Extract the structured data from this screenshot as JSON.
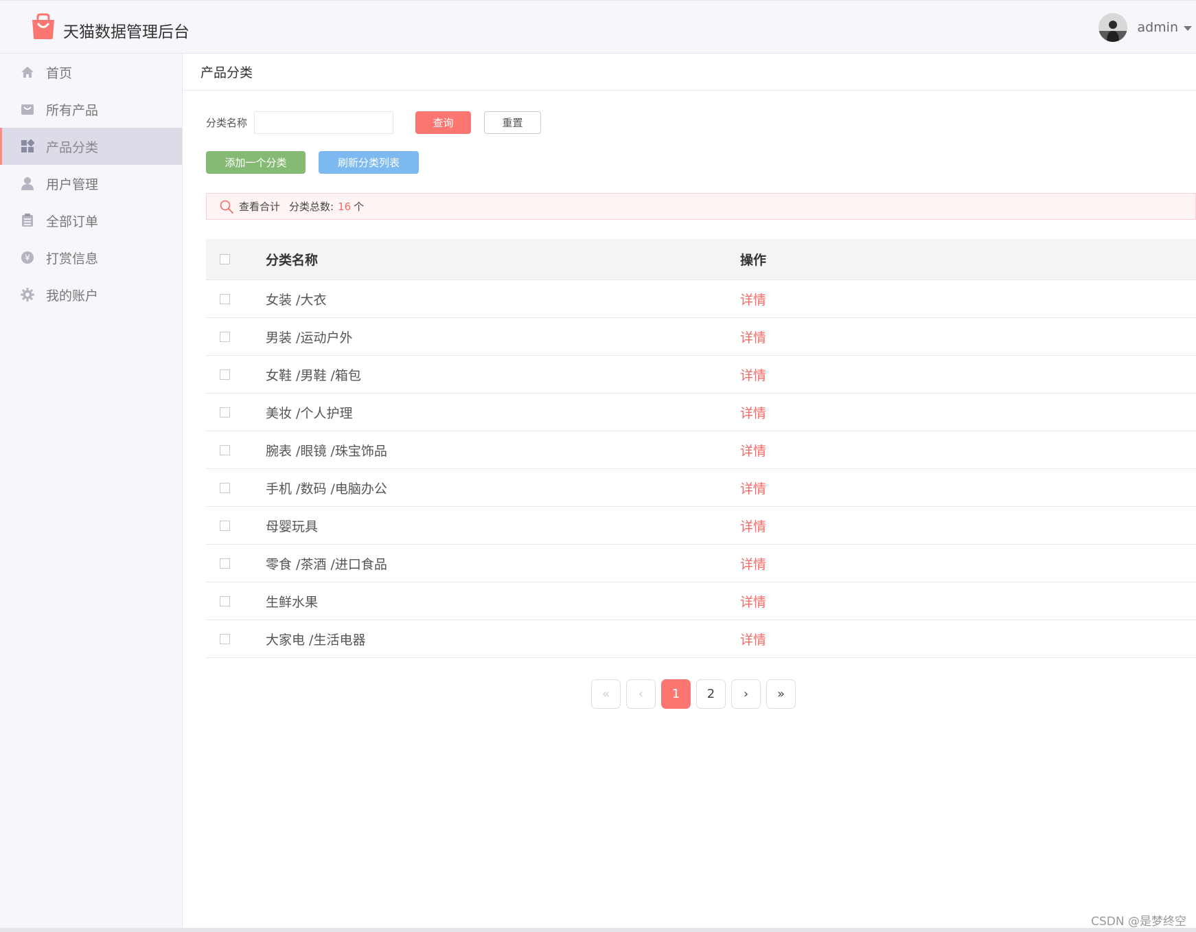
{
  "header": {
    "app_title": "天猫数据管理后台",
    "username": "admin"
  },
  "sidebar": {
    "items": [
      {
        "label": "首页",
        "icon": "home-icon",
        "active": false
      },
      {
        "label": "所有产品",
        "icon": "bag-icon",
        "active": false
      },
      {
        "label": "产品分类",
        "icon": "category-icon",
        "active": true
      },
      {
        "label": "用户管理",
        "icon": "user-icon",
        "active": false
      },
      {
        "label": "全部订单",
        "icon": "order-icon",
        "active": false
      },
      {
        "label": "打赏信息",
        "icon": "yen-icon",
        "active": false
      },
      {
        "label": "我的账户",
        "icon": "gear-icon",
        "active": false
      }
    ]
  },
  "breadcrumb": "产品分类",
  "search": {
    "label": "分类名称",
    "value": "",
    "placeholder": "",
    "query_label": "查询",
    "reset_label": "重置"
  },
  "actions": {
    "add_label": "添加一个分类",
    "refresh_label": "刷新分类列表"
  },
  "summary": {
    "label": "查看合计",
    "total_label": "分类总数:",
    "count": "16",
    "unit": "个"
  },
  "table": {
    "headers": {
      "name": "分类名称",
      "op": "操作"
    },
    "rows": [
      {
        "name": "女装 /大衣",
        "op": "详情"
      },
      {
        "name": "男装 /运动户外",
        "op": "详情"
      },
      {
        "name": "女鞋 /男鞋 /箱包",
        "op": "详情"
      },
      {
        "name": "美妆 /个人护理",
        "op": "详情"
      },
      {
        "name": "腕表 /眼镜 /珠宝饰品",
        "op": "详情"
      },
      {
        "name": "手机 /数码 /电脑办公",
        "op": "详情"
      },
      {
        "name": "母婴玩具",
        "op": "详情"
      },
      {
        "name": "零食 /茶酒 /进口食品",
        "op": "详情"
      },
      {
        "name": "生鲜水果",
        "op": "详情"
      },
      {
        "name": "大家电 /生活电器",
        "op": "详情"
      }
    ]
  },
  "pagination": {
    "first": "«",
    "prev": "‹",
    "pages": [
      "1",
      "2"
    ],
    "current": "1",
    "next": "›",
    "last": "»"
  },
  "watermark": "CSDN @是梦终空",
  "colors": {
    "accent": "#fc7671",
    "add_button": "#85ba74",
    "refresh_button": "#7cb9f1",
    "sidebar_bg": "#f7f7fb",
    "active_item_bg": "#dcdce8"
  }
}
